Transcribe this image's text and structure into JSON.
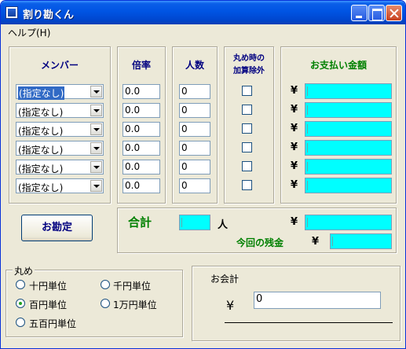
{
  "window": {
    "title": "割り勘くん"
  },
  "menu": {
    "help": "ヘルプ(H)"
  },
  "columns": {
    "member": "メンバー",
    "rate": "倍率",
    "count": "人数",
    "exclude_line1": "丸め時の",
    "exclude_line2": "加算除外",
    "payment": "お支払い金額"
  },
  "rows": [
    {
      "member": "(指定なし)",
      "rate": "0.0",
      "count": "0",
      "yen": "¥"
    },
    {
      "member": "(指定なし)",
      "rate": "0.0",
      "count": "0",
      "yen": "¥"
    },
    {
      "member": "(指定なし)",
      "rate": "0.0",
      "count": "0",
      "yen": "¥"
    },
    {
      "member": "(指定なし)",
      "rate": "0.0",
      "count": "0",
      "yen": "¥"
    },
    {
      "member": "(指定なし)",
      "rate": "0.0",
      "count": "0",
      "yen": "¥"
    },
    {
      "member": "(指定なし)",
      "rate": "0.0",
      "count": "0",
      "yen": "¥"
    }
  ],
  "settle_button": "お勘定",
  "total": {
    "label": "合計",
    "people_unit": "人",
    "yen": "¥"
  },
  "remainder": {
    "label": "今回の残金",
    "yen": "¥"
  },
  "rounding": {
    "title": "丸め",
    "options": [
      "十円単位",
      "千円単位",
      "百円単位",
      "1万円単位",
      "五百円単位"
    ],
    "selected": "百円単位"
  },
  "bill": {
    "title": "お会計",
    "yen": "¥",
    "value": "0"
  },
  "colors": {
    "accent_green": "#008000",
    "accent_navy": "#000080",
    "cyan": "#00ffff"
  }
}
